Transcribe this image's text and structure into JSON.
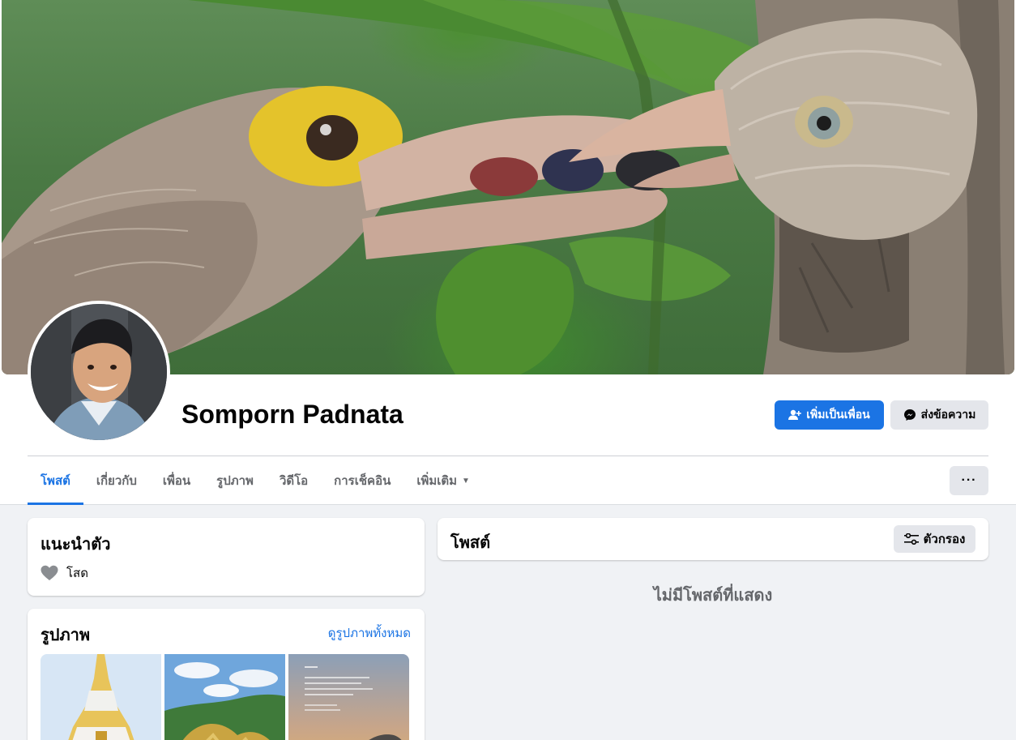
{
  "profile": {
    "name": "Somporn Padnata",
    "add_friend_label": "เพิ่มเป็นเพื่อน",
    "message_label": "ส่งข้อความ"
  },
  "tabs": [
    {
      "label": "โพสต์",
      "active": true
    },
    {
      "label": "เกี่ยวกับ"
    },
    {
      "label": "เพื่อน"
    },
    {
      "label": "รูปภาพ"
    },
    {
      "label": "วิดีโอ"
    },
    {
      "label": "การเช็คอิน"
    },
    {
      "label": "เพิ่มเติม"
    }
  ],
  "more_options_label": "···",
  "intro": {
    "title": "แนะนำตัว",
    "relationship": "โสด"
  },
  "photos": {
    "title": "รูปภาพ",
    "see_all": "ดูรูปภาพทั้งหมด"
  },
  "posts": {
    "title": "โพสต์",
    "filter_label": "ตัวกรอง",
    "empty_text": "ไม่มีโพสต์ที่แสดง"
  },
  "colors": {
    "accent": "#1b74e4",
    "background": "#f0f2f5",
    "secondary_button": "#e4e6eb",
    "muted_text": "#65676b"
  }
}
